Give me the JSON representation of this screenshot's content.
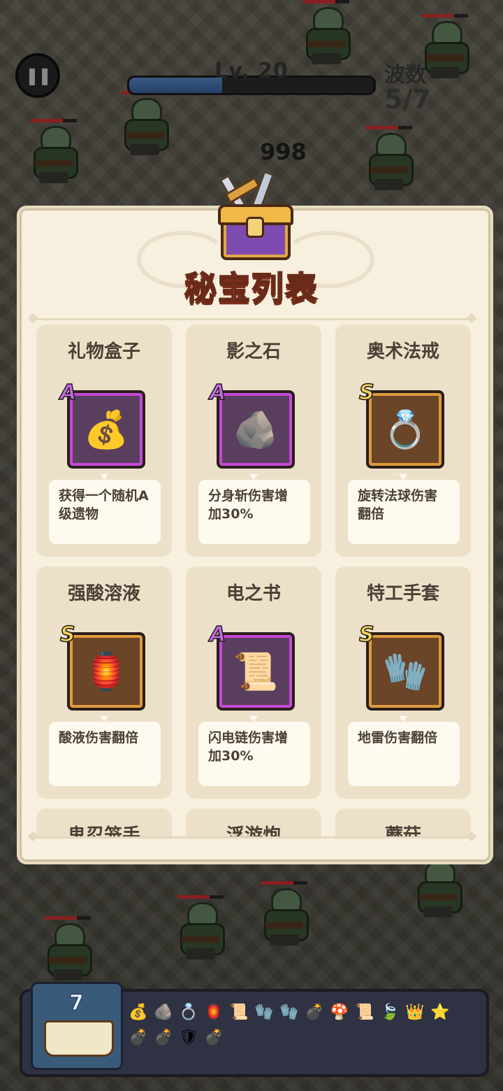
{
  "hud": {
    "pause_icon": "pause-icon",
    "level_text": "Lv. 20",
    "level_progress": 0.38,
    "wave_label": "波数",
    "wave_value": "5/7",
    "damage_number": "998"
  },
  "modal": {
    "title": "秘宝列表",
    "chest_icon": "treasure-chest-icon",
    "cards": [
      {
        "name": "礼物盒子",
        "grade": "A",
        "icon": "gift-bag-icon",
        "glyph": "💰",
        "desc": "获得一个随机A级遗物"
      },
      {
        "name": "影之石",
        "grade": "A",
        "icon": "shadow-stone-icon",
        "glyph": "🪨",
        "desc": "分身斩伤害增加30%"
      },
      {
        "name": "奥术法戒",
        "grade": "S",
        "icon": "arcane-ring-icon",
        "glyph": "💍",
        "desc": "旋转法球伤害翻倍"
      },
      {
        "name": "强酸溶液",
        "grade": "S",
        "icon": "lantern-icon",
        "glyph": "🏮",
        "desc": "酸液伤害翻倍"
      },
      {
        "name": "电之书",
        "grade": "A",
        "icon": "scroll-icon",
        "glyph": "📜",
        "desc": "闪电链伤害增加30%"
      },
      {
        "name": "特工手套",
        "grade": "S",
        "icon": "gauntlet-icon",
        "glyph": "🧤",
        "desc": "地雷伤害翻倍"
      },
      {
        "name": "鬼忍笼手",
        "grade": "",
        "icon": "",
        "glyph": "",
        "desc": ""
      },
      {
        "name": "浮游炮",
        "grade": "",
        "icon": "",
        "glyph": "",
        "desc": ""
      },
      {
        "name": "蘑菇",
        "grade": "",
        "icon": "",
        "glyph": "",
        "desc": ""
      }
    ]
  },
  "bottom": {
    "book_count": "7",
    "book_icon": "spellbook-icon",
    "relics_row1": [
      "💰",
      "🪨",
      "💍",
      "🏮",
      "📜",
      "🧤",
      "🧤",
      "💣",
      "🍄",
      "📜",
      "🍃",
      "👑",
      "⭐"
    ],
    "relics_row2": [
      "💣",
      "💣",
      "🛡",
      "💣"
    ]
  }
}
